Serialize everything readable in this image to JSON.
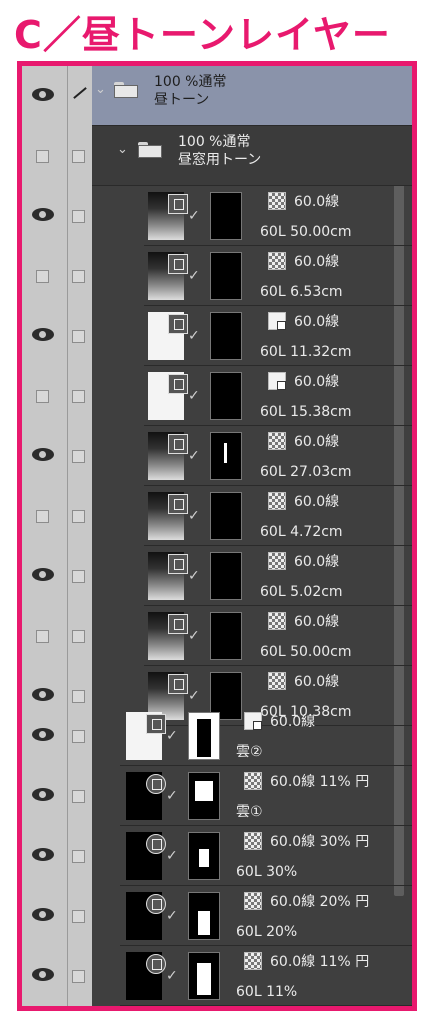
{
  "title": "C／昼トーンレイヤー",
  "accent_color": "#e8196e",
  "folders": [
    {
      "line1": "100 %通常",
      "line2": "昼トーン"
    },
    {
      "line1": "100 %通常",
      "line2": "昼窓用トーン"
    }
  ],
  "layers": [
    {
      "tone": "60.0線",
      "name": "60L 50.00cm"
    },
    {
      "tone": "60.0線",
      "name": "60L 6.53cm"
    },
    {
      "tone": "60.0線",
      "name": "60L 11.32cm"
    },
    {
      "tone": "60.0線",
      "name": "60L 15.38cm"
    },
    {
      "tone": "60.0線",
      "name": "60L 27.03cm"
    },
    {
      "tone": "60.0線",
      "name": "60L 4.72cm"
    },
    {
      "tone": "60.0線",
      "name": "60L 5.02cm"
    },
    {
      "tone": "60.0線",
      "name": "60L 50.00cm"
    },
    {
      "tone": "60.0線",
      "name": "60L 10.38cm"
    },
    {
      "tone": "60.0線",
      "name": "雲②"
    },
    {
      "tone": "60.0線 11% 円",
      "name": "雲①"
    },
    {
      "tone": "60.0線 30% 円",
      "name": "60L 30%"
    },
    {
      "tone": "60.0線 20% 円",
      "name": "60L 20%"
    },
    {
      "tone": "60.0線 11% 円",
      "name": "60L 11%"
    }
  ]
}
